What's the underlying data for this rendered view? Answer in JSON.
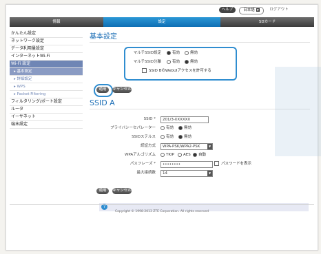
{
  "topbar": {
    "help": "ヘルプ",
    "language": "日本語",
    "logout": "ログアウト"
  },
  "nav": {
    "info": "情報",
    "settings": "設定",
    "sdcard": "SDカード"
  },
  "sidebar": {
    "items": [
      {
        "label": "かんたん設定"
      },
      {
        "label": "ネットワーク設定"
      },
      {
        "label": "データ利用量設定"
      },
      {
        "label": "インターネットWi-Fi"
      },
      {
        "label": "Wi-Fi 設定"
      },
      {
        "label": "▸ 基本設定"
      },
      {
        "label": "▸ 詳細設定"
      },
      {
        "label": "▸ WPS"
      },
      {
        "label": "▸ Packet Filtering"
      },
      {
        "label": "フィルタリング/ポート設定"
      },
      {
        "label": "ルータ"
      },
      {
        "label": "イーサネット"
      },
      {
        "label": "端末設定"
      }
    ]
  },
  "main": {
    "title": "基本設定",
    "multi_ssid": {
      "label": "マルチSSID設定",
      "on": "有効",
      "off": "無効",
      "selected": "on"
    },
    "ssid_separation": {
      "label": "マルチSSID分離",
      "on": "有効",
      "off": "無効",
      "selected": "off"
    },
    "guest_checkbox": {
      "label": "SSID BのWebUIアクセスを許可する",
      "checked": false
    },
    "apply": "適用",
    "cancel": "キャンセル",
    "ssid_a_title": "SSID A",
    "ssid": {
      "label": "SSID *",
      "value": "201/3-XXXXXX"
    },
    "privacy_separator": {
      "label": "プライバシーセパレーター",
      "on": "有効",
      "off": "無効",
      "selected": "off"
    },
    "ssid_stealth": {
      "label": "SSIDステルス",
      "on": "有効",
      "off": "無効",
      "selected": "off"
    },
    "auth_method": {
      "label": "認証方式",
      "value": "WPA-PSK/WPA2-PSK"
    },
    "wpa_algorithm": {
      "label": "WPAアルゴリズム",
      "tkip": "TKIP",
      "aes": "AES",
      "auto": "自動",
      "selected": "auto"
    },
    "passphrase": {
      "label": "パスフレーズ *",
      "value": "••••••••",
      "show_label": "パスワードを表示"
    },
    "max_connections": {
      "label": "最大接続数",
      "value": "14"
    },
    "apply2": "適用",
    "cancel2": "キャンセル",
    "help_icon": "?"
  },
  "footer": {
    "copyright": "Copyright © 1998-2013 ZTE Corporation. All rights reserved"
  },
  "colors": {
    "accent": "#1a6db5",
    "highlight": "#2f8dd0",
    "sidebar_active": "#6f86b5"
  }
}
